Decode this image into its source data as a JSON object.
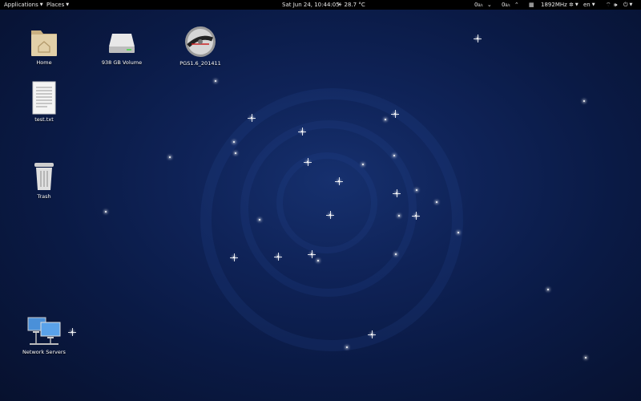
{
  "topbar": {
    "applications": "Applications",
    "places": "Places",
    "datetime": "Sat Jun 24, 10:44:05",
    "weather": "28.7 °C",
    "net_down": "0",
    "net_down_unit": "B/s",
    "net_up": "0",
    "net_up_unit": "B/s",
    "cpu_freq": "1892MHz",
    "language": "en"
  },
  "desktop": {
    "icons": [
      {
        "label": "Home",
        "icon": "folder-home-icon"
      },
      {
        "label": "938 GB Volume",
        "icon": "drive-icon"
      },
      {
        "label": "PGS1.6_201411",
        "icon": "disc-icon"
      },
      {
        "label": "test.txt",
        "icon": "text-file-icon"
      },
      {
        "label": "Trash",
        "icon": "trash-icon"
      },
      {
        "label": "Network Servers",
        "icon": "network-icon"
      }
    ]
  },
  "colors": {
    "panel": "#000000",
    "wallpaper": "#0f2358"
  }
}
